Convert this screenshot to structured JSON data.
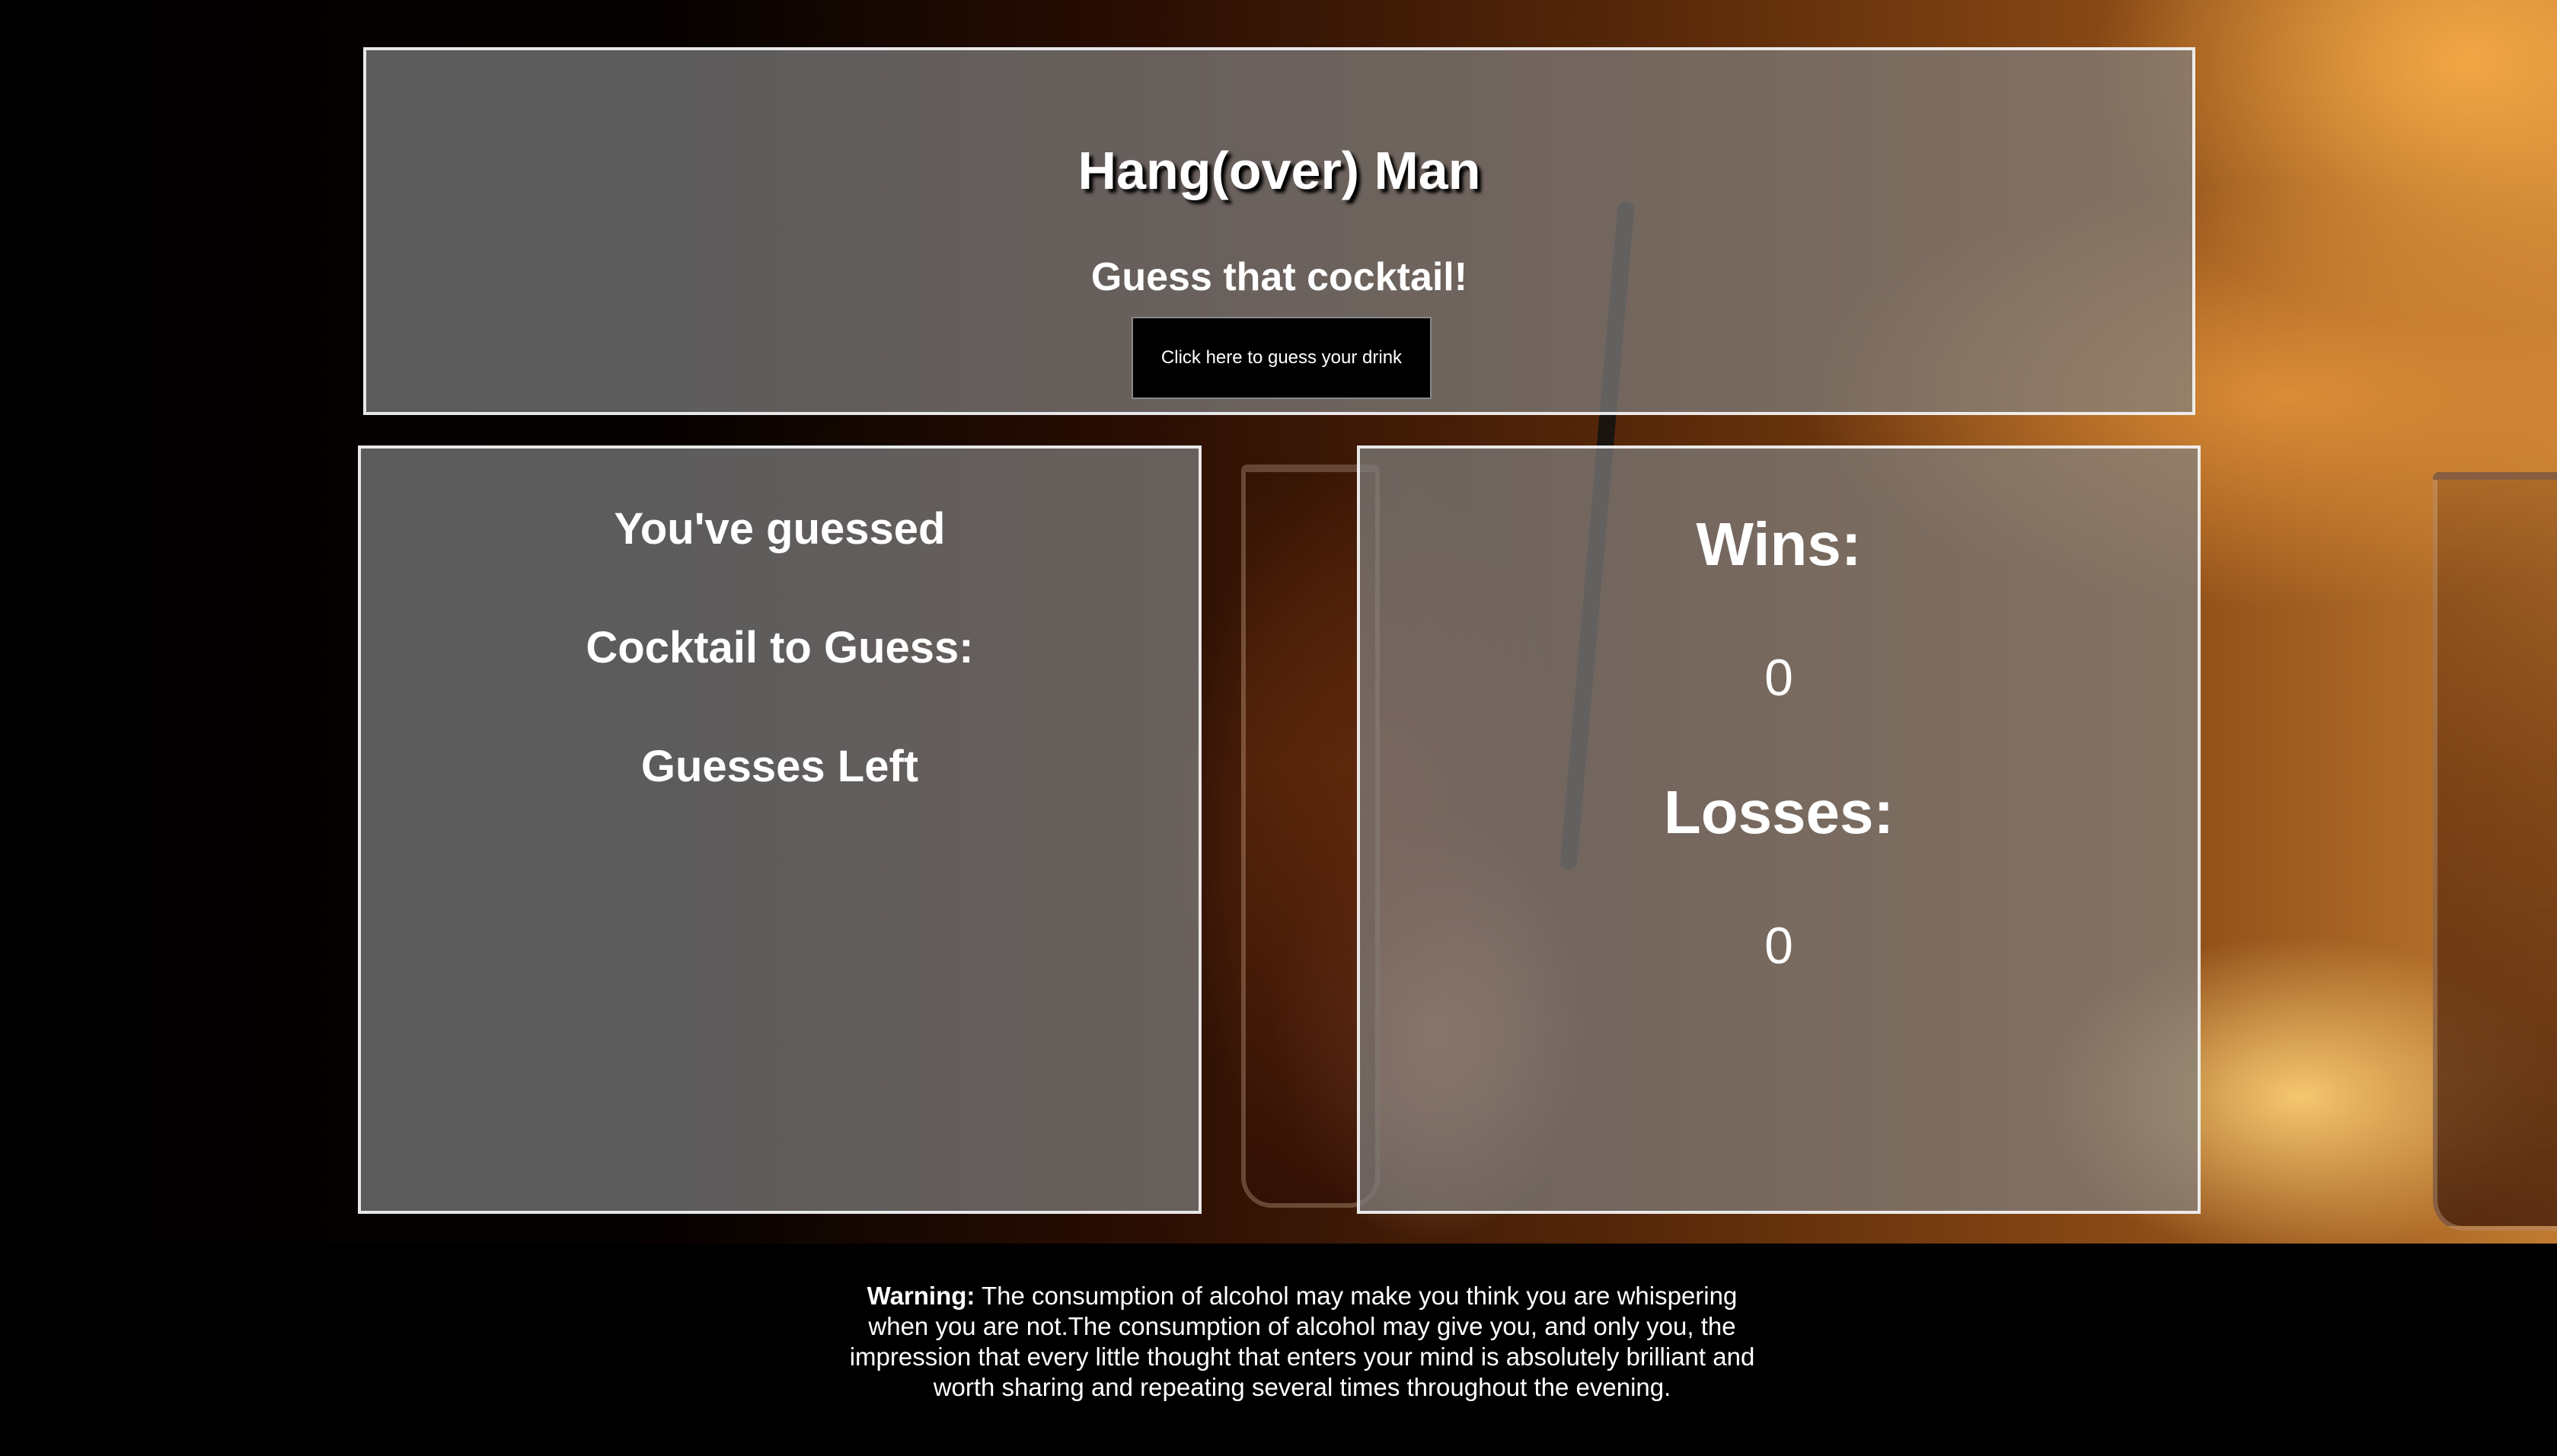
{
  "header": {
    "title": "Hang(over) Man",
    "subtitle": "Guess that cocktail!",
    "guess_button_label": "Click here to guess your drink"
  },
  "game": {
    "guessed_label": "You've guessed",
    "cocktail_label": "Cocktail to Guess:",
    "guesses_left_label": "Guesses Left"
  },
  "scoreboard": {
    "wins_label": "Wins:",
    "wins_value": "0",
    "losses_label": "Losses:",
    "losses_value": "0"
  },
  "footer": {
    "warning_label": "Warning:",
    "warning_text": " The consumption of alcohol may make you think you are whispering when you are not.The consumption of alcohol may give you, and only you, the impression that every little thought that enters your mind is absolutely brilliant and worth sharing and repeating several times throughout the evening."
  }
}
